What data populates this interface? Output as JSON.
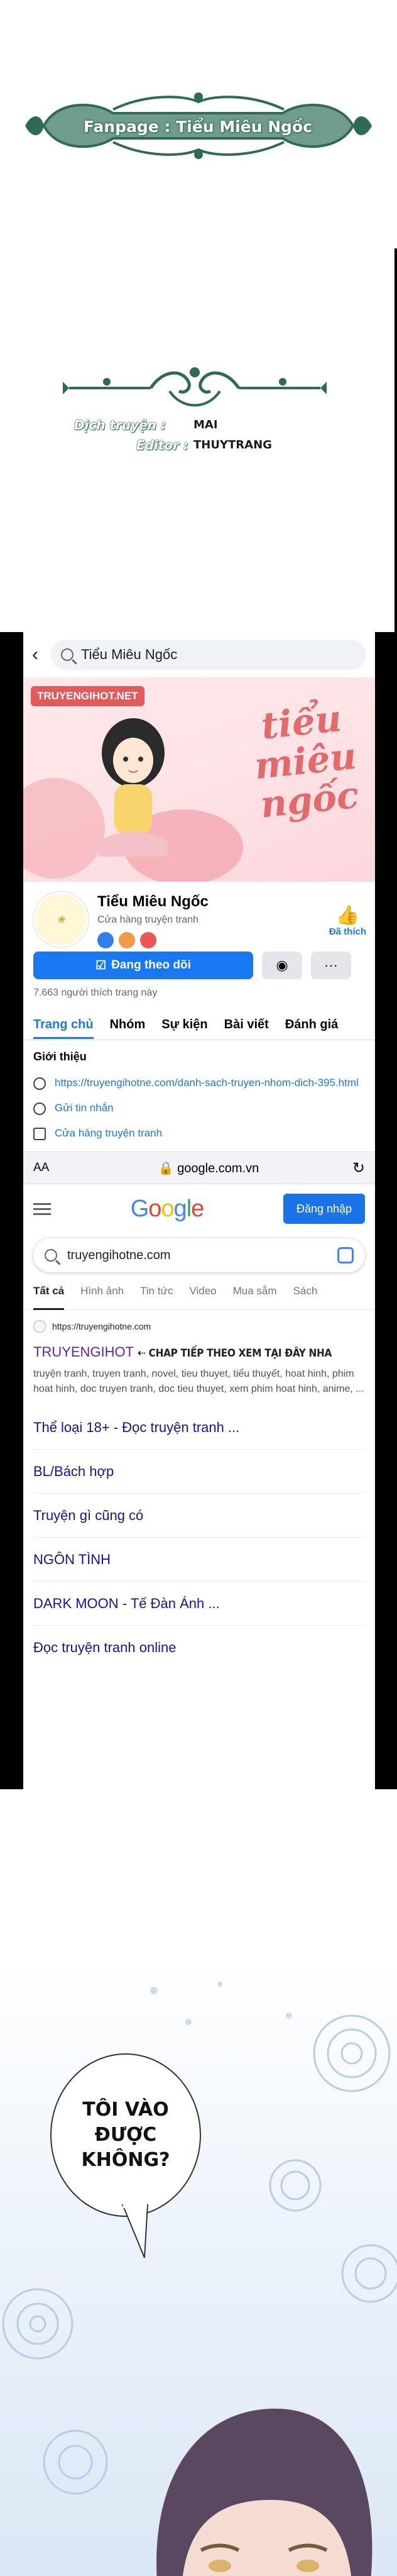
{
  "credits": {
    "fanpage_label": "Fanpage : Tiểu Miêu Ngốc",
    "translator_key": "Dịch truyện :",
    "translator_value": "MAI",
    "editor_key": "Editor :",
    "editor_value": "THUYTRANG"
  },
  "facebook": {
    "search_value": "Tiểu Miêu Ngốc",
    "cover": {
      "tag": "TRUYENGIHOT.NET",
      "title_line1": "tiểu",
      "title_line2": "miêu",
      "title_line3": "ngốc"
    },
    "page_name": "Tiểu Miêu Ngốc",
    "page_category": "Cửa hàng truyện tranh",
    "liked_label": "Đã thích",
    "follow_button": "Đang theo dõi",
    "likes_count": "7.663 người thích trang này",
    "tabs": [
      "Trang chủ",
      "Nhóm",
      "Sự kiện",
      "Bài viết",
      "Đánh giá"
    ],
    "intro_heading": "Giới thiệu",
    "intro_link": "https://truyengihotne.com/danh-sach-truyen-nhom-dich-395.html",
    "intro_message": "Gửi tin nhắn",
    "intro_category": "Cửa hàng truyện tranh"
  },
  "browser": {
    "aa_label": "AA",
    "url": "google.com.vn"
  },
  "google": {
    "signin_button": "Đăng nhập",
    "search_value": "truyengihotne.com",
    "tabs": [
      "Tất cả",
      "Hình ảnh",
      "Tin tức",
      "Video",
      "Mua sắm",
      "Sách"
    ],
    "result": {
      "site": "https://truyengihotne.com",
      "title": "TRUYENGIHOT",
      "title_extra": "⇠ CHAP TIẾP THEO XEM TẠI ĐÂY NHA",
      "description": "truyện tranh, truyen tranh, novel, tieu thuyet, tiểu thuyết, hoat hinh, phim hoat hinh, doc truyen tranh, doc tieu thuyet, xem phim hoat hinh, anime, ..."
    },
    "sitelinks": [
      "Thể loại 18+ - Đọc truyện tranh ...",
      "BL/Bách hợp",
      "Truyện gì cũng có",
      "NGÔN TÌNH",
      "DARK MOON - Tế Đàn Ánh ...",
      "Đọc truyện tranh online"
    ]
  },
  "manga": {
    "bubble_line1": "TÔI VÀO",
    "bubble_line2": "ĐƯỢC",
    "bubble_line3": "KHÔNG?"
  },
  "colors": {
    "fb_blue": "#1877f2",
    "google_blue": "#1a73e8",
    "ornament_green": "#2e6b56"
  }
}
